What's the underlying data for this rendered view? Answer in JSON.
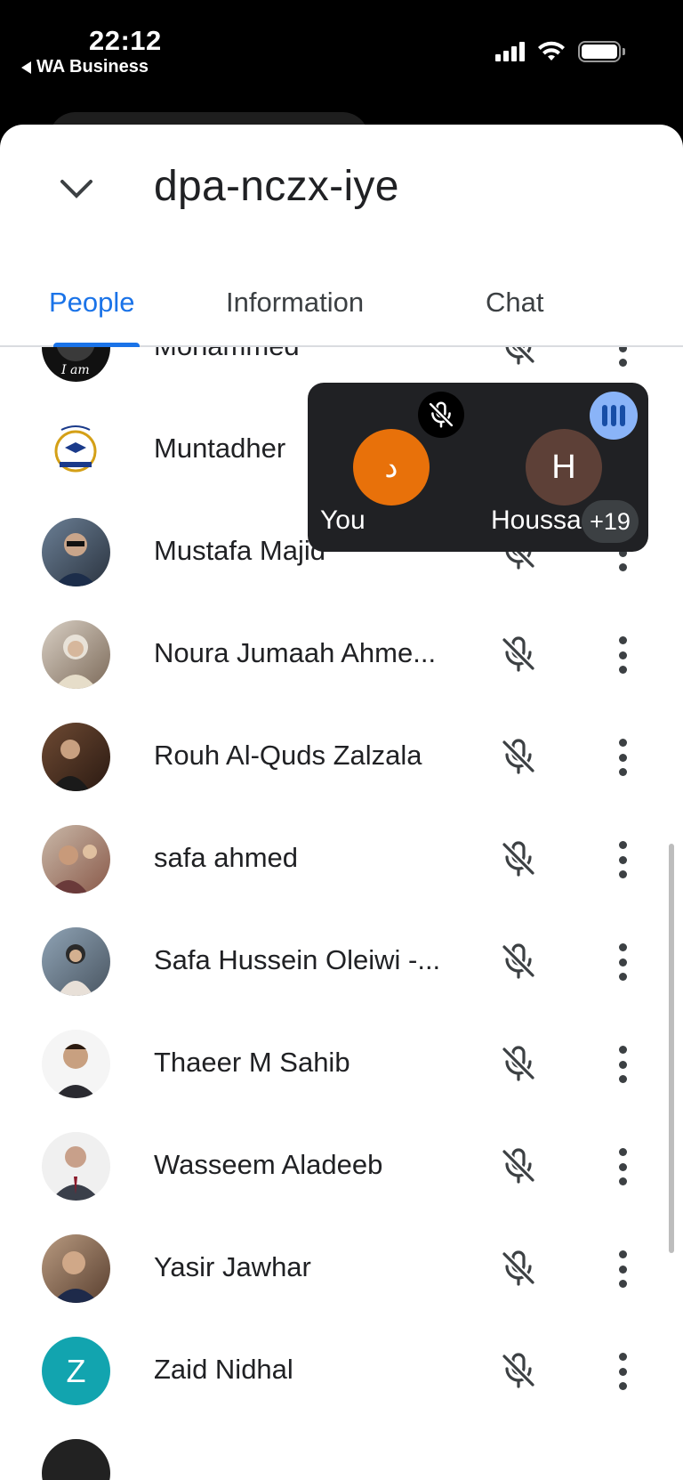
{
  "status_bar": {
    "time": "22:12",
    "back_app": "WA Business"
  },
  "header": {
    "meeting_code": "dpa-nczx-iye"
  },
  "tabs": [
    {
      "label": "People",
      "active": true
    },
    {
      "label": "Information",
      "active": false
    },
    {
      "label": "Chat",
      "active": false
    }
  ],
  "participants": [
    {
      "name": "Mohammed",
      "avatar": "photo"
    },
    {
      "name": "Muntadher",
      "avatar": "logo"
    },
    {
      "name": "Mustafa Majid",
      "avatar": "photo"
    },
    {
      "name": "Noura Jumaah Ahme...",
      "avatar": "photo"
    },
    {
      "name": "Rouh Al-Quds Zalzala",
      "avatar": "photo"
    },
    {
      "name": "safa ahmed",
      "avatar": "photo"
    },
    {
      "name": "Safa Hussein Oleiwi -...",
      "avatar": "photo"
    },
    {
      "name": "Thaeer M Sahib",
      "avatar": "photo"
    },
    {
      "name": "Wasseem Aladeeb",
      "avatar": "photo"
    },
    {
      "name": "Yasir Jawhar",
      "avatar": "photo"
    },
    {
      "name": "Zaid Nidhal",
      "avatar": "initial",
      "initial": "Z"
    }
  ],
  "call_pip": {
    "you_initial": "د",
    "you_label": "You",
    "other_initial": "H",
    "other_label": "Houssa",
    "extra_count": "+19"
  },
  "colors": {
    "accent": "#1a73e8",
    "you_avatar": "#e8710a",
    "other_avatar": "#5d4037",
    "zaid_avatar": "#12a4af"
  }
}
